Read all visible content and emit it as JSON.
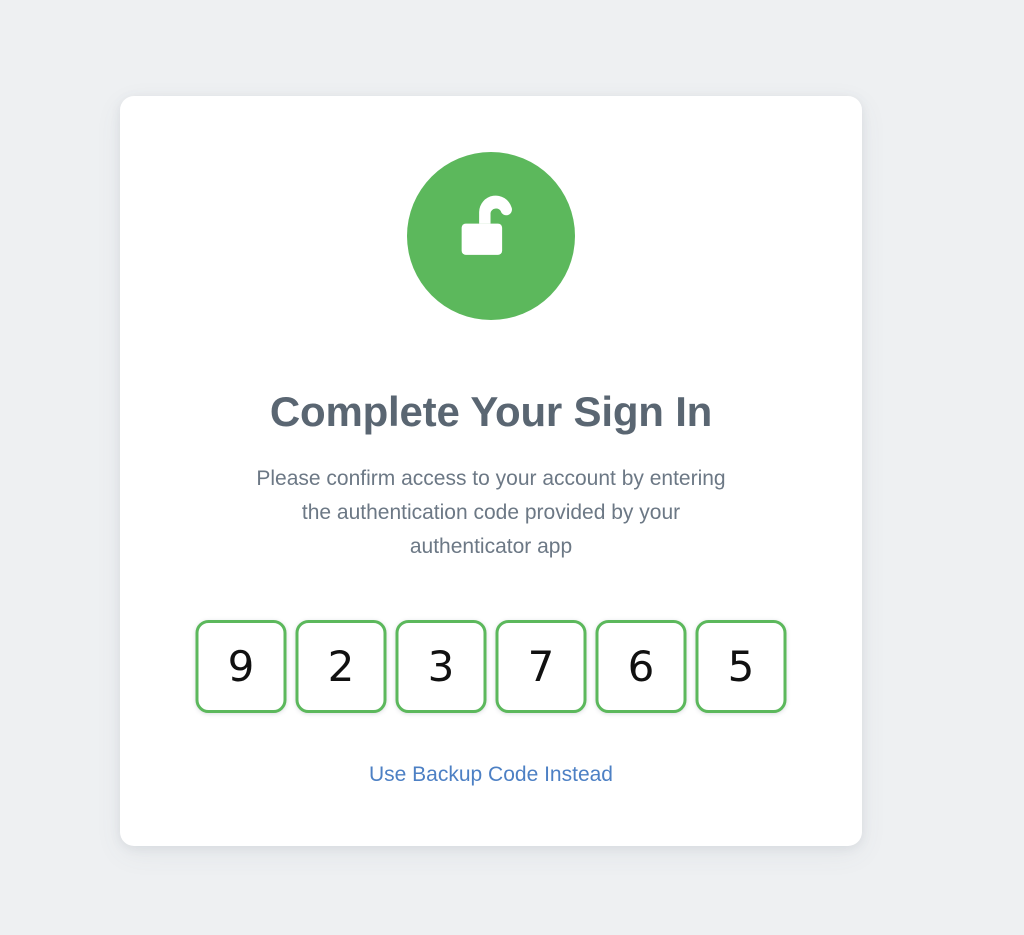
{
  "page": {
    "background_color": "#eef0f2"
  },
  "card": {
    "background_color": "#ffffff",
    "badge": {
      "icon": "open-padlock-icon",
      "circle_color": "#5cb85c",
      "glyph_color": "#ffffff"
    },
    "title": "Complete Your Sign In",
    "title_color": "#5a6672",
    "subtitle": "Please confirm access to your account by entering the authentication code provided by your authenticator app",
    "subtitle_color": "#6c7885",
    "otp": {
      "length": 6,
      "border_color": "#5cb85c",
      "digit_color": "#111111",
      "digits": [
        "9",
        "2",
        "3",
        "7",
        "6",
        "5"
      ],
      "code": "923765",
      "placeholder": ""
    },
    "backup_link": {
      "label": "Use Backup Code Instead",
      "color": "#4d80c4"
    }
  }
}
